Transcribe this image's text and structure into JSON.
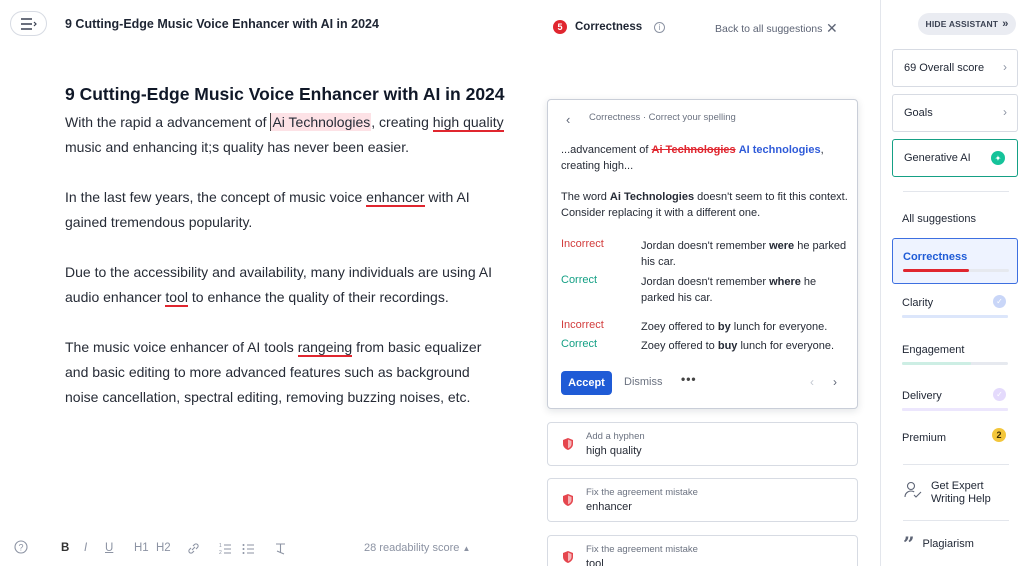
{
  "header": {
    "title": "9 Cutting-Edge Music Voice Enhancer with AI in 2024"
  },
  "editor": {
    "heading": "9 Cutting-Edge Music Voice Enhancer with AI in 2024",
    "p1": {
      "a": "With the rapid a advancement of ",
      "flag1": "Ai Technologies",
      "b": ", creating ",
      "flag2": "high quality",
      "c": " music and enhancing it;s quality has never been easier."
    },
    "p2": {
      "a": "In the last few years, the concept of music voice ",
      "flag": "enhancer",
      "b": " with AI gained tremendous popularity."
    },
    "p3": {
      "a": "Due to the accessibility and availability, many individuals are using AI audio enhancer ",
      "flag": "tool",
      "b": " to enhance the quality of their recordings."
    },
    "p4": {
      "a": "The music voice enhancer of AI tools ",
      "flag": "rangeing",
      "b": " from basic equalizer and basic editing to more advanced features such as background noise cancellation, spectral editing, removing buzzing noises, etc."
    }
  },
  "toolbar": {
    "bold": "B",
    "italic": "I",
    "underline": "U",
    "h1": "H1",
    "h2": "H2",
    "readability": "28 readability score"
  },
  "suggestions": {
    "count": "5",
    "category": "Correctness",
    "back_link": "Back to all suggestions",
    "card": {
      "breadcrumb": "Correctness · Correct your spelling",
      "excerpt_pre": "...advancement of ",
      "excerpt_wrong": "Ai Technologies",
      "excerpt_fix": "AI technologies",
      "excerpt_post": ", creating high...",
      "explain_pre": "The word ",
      "explain_word": "Ai Technologies",
      "explain_post": " doesn't seem to fit this context. Consider replacing it with a different one.",
      "examples": [
        {
          "label": "Incorrect",
          "pre": "Jordan doesn't remember ",
          "bold": "were",
          "post": " he parked his car."
        },
        {
          "label": "Correct",
          "pre": "Jordan doesn't remember ",
          "bold": "where",
          "post": " he parked his car."
        },
        {
          "label": "Incorrect",
          "pre": "Zoey offered to ",
          "bold": "by",
          "post": " lunch for everyone."
        },
        {
          "label": "Correct",
          "pre": "Zoey offered to ",
          "bold": "buy",
          "post": " lunch for everyone."
        }
      ],
      "accept": "Accept",
      "dismiss": "Dismiss",
      "more": "•••"
    },
    "items": [
      {
        "kind": "Add a hyphen",
        "word": "high quality"
      },
      {
        "kind": "Fix the agreement mistake",
        "word": "enhancer"
      },
      {
        "kind": "Fix the agreement mistake",
        "word": "tool"
      }
    ]
  },
  "sidebar": {
    "hide_label": "HIDE ASSISTANT",
    "overall_score": "69 Overall score",
    "goals": "Goals",
    "generative_ai": "Generative AI",
    "all_suggestions": "All suggestions",
    "categories": [
      {
        "label": "Correctness",
        "color": "#e0262f"
      },
      {
        "label": "Clarity",
        "color": "#4a7df0"
      },
      {
        "label": "Engagement",
        "color": "#15a085"
      },
      {
        "label": "Delivery",
        "color": "#8a5cf6"
      },
      {
        "label": "Premium",
        "badge": "2"
      }
    ],
    "expert_help": "Get Expert Writing Help",
    "plagiarism": "Plagiarism"
  },
  "colors": {
    "accent": "#1f5bd6",
    "error": "#e0262f",
    "success": "#15a085"
  }
}
